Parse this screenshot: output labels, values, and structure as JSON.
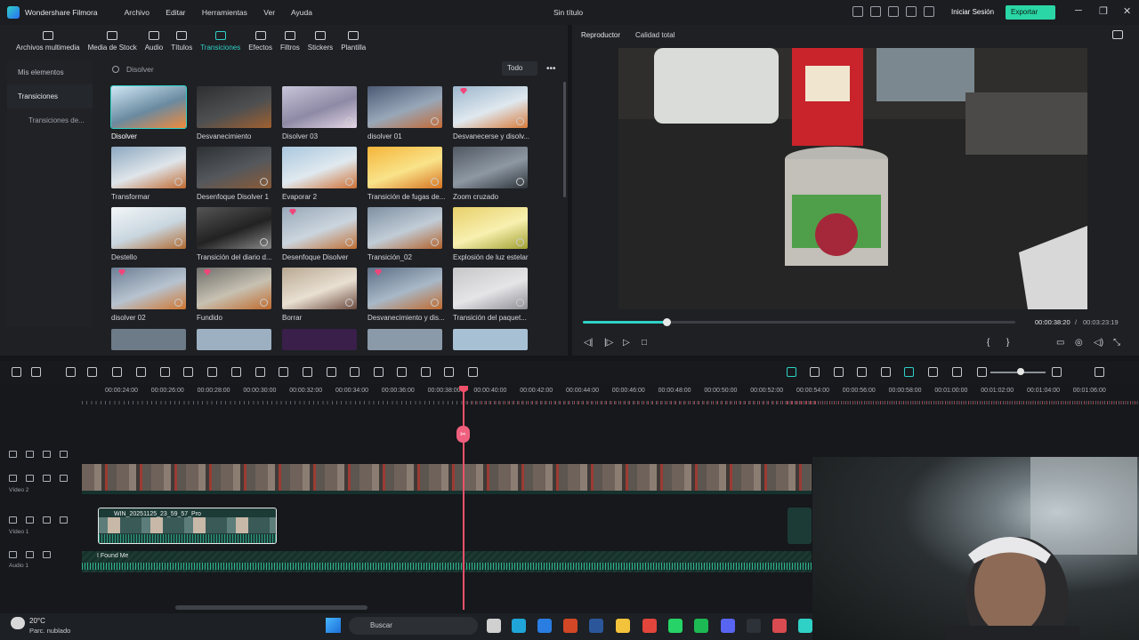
{
  "app": {
    "name": "Wondershare Filmora",
    "menu": [
      "Archivo",
      "Editar",
      "Herramientas",
      "Ver",
      "Ayuda"
    ],
    "window_title": "Sin título",
    "login": "Iniciar Sesión",
    "export": "Exportar"
  },
  "library": {
    "tabs": [
      {
        "label": "Archivos multimedia",
        "icon": "media-icon"
      },
      {
        "label": "Media de Stock",
        "icon": "stock-icon"
      },
      {
        "label": "Audio",
        "icon": "music-icon"
      },
      {
        "label": "Títulos",
        "icon": "title-icon"
      },
      {
        "label": "Transiciones",
        "icon": "transition-icon",
        "active": true
      },
      {
        "label": "Efectos",
        "icon": "effects-icon"
      },
      {
        "label": "Filtros",
        "icon": "filters-icon"
      },
      {
        "label": "Stickers",
        "icon": "stickers-icon"
      },
      {
        "label": "Plantilla",
        "icon": "template-icon"
      }
    ],
    "sidebar": [
      "Mis elementos",
      "Transiciones",
      "Transiciones de..."
    ],
    "search_value": "Disolver",
    "filter": "Todo",
    "items": [
      {
        "label": "Disolver",
        "selected": true
      },
      {
        "label": "Desvanecimiento"
      },
      {
        "label": "Disolver 03"
      },
      {
        "label": "disolver 01"
      },
      {
        "label": "Desvanecerse y disolv...",
        "premium": true
      },
      {
        "label": "Transformar"
      },
      {
        "label": "Desenfoque Disolver 1"
      },
      {
        "label": "Evaporar 2"
      },
      {
        "label": "Transición de fugas de..."
      },
      {
        "label": "Zoom cruzado"
      },
      {
        "label": "Destello"
      },
      {
        "label": "Transición del diario d..."
      },
      {
        "label": "Desenfoque Disolver",
        "premium": true
      },
      {
        "label": "Transición_02"
      },
      {
        "label": "Explosión de luz estelar"
      },
      {
        "label": "disolver 02",
        "premium": true
      },
      {
        "label": "Fundido",
        "premium": true
      },
      {
        "label": "Borrar"
      },
      {
        "label": "Desvanecimiento y dis...",
        "premium": true
      },
      {
        "label": "Transición del paquet..."
      }
    ]
  },
  "player": {
    "label": "Reproductor",
    "quality": "Calidad total",
    "current_time": "00:00:38:20",
    "separator": "/",
    "total_time": "00:03:23:19",
    "progress": 0.19
  },
  "timeline": {
    "ruler": [
      "00:00:24:00",
      "00:00:26:00",
      "00:00:28:00",
      "00:00:30:00",
      "00:00:32:00",
      "00:00:34:00",
      "00:00:36:00",
      "00:00:38:00",
      "00:00:40:00",
      "00:00:42:00",
      "00:00:44:00",
      "00:00:46:00",
      "00:00:48:00",
      "00:00:50:00",
      "00:00:52:00",
      "00:00:54:00",
      "00:00:56:00",
      "00:00:58:00",
      "00:01:00:00",
      "00:01:02:00",
      "00:01:04:00",
      "00:01:06:00"
    ],
    "tracks": {
      "v2_name": "Vídeo 2",
      "v1_name": "Vídeo 1",
      "a1_name": "Audio 1",
      "v1_clip": "WIN_20251125_23_59_57_Pro",
      "audio_clip": "I Found Me"
    }
  },
  "taskbar": {
    "temp": "20°C",
    "weather": "Parc. nublado",
    "search": "Buscar"
  }
}
